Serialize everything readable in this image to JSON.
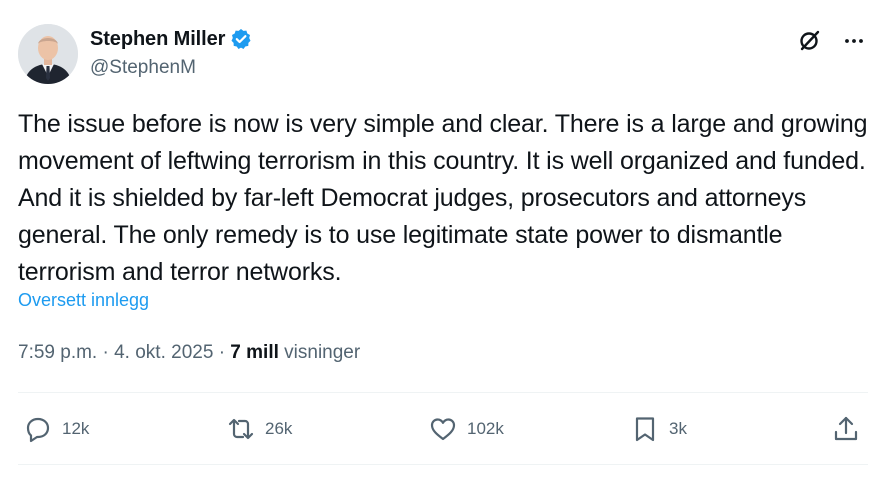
{
  "author": {
    "display_name": "Stephen Miller",
    "handle": "@StephenM",
    "verified": true,
    "verified_color": "#1d9bf0"
  },
  "header_actions": {
    "grok_icon": "grok-icon",
    "more_icon": "more-icon"
  },
  "tweet": {
    "text": "The issue before is now is very simple and clear. There is a large and growing movement of leftwing terrorism in this country. It is well organized and funded. And it is shielded by far-left Democrat judges, prosecutors and attorneys general. The only remedy is to use legitimate state power to dismantle terrorism and terror networks.",
    "translate_label": "Oversett innlegg"
  },
  "meta": {
    "time": "7:59 p.m.",
    "separator": "·",
    "date": "4. okt. 2025",
    "views_count": "7 mill",
    "views_label": "visninger"
  },
  "engagement": {
    "replies": "12k",
    "reposts": "26k",
    "likes": "102k",
    "bookmarks": "3k"
  },
  "colors": {
    "text": "#0f1419",
    "secondary": "#536471",
    "accent": "#1d9bf0",
    "divider": "#eff3f4"
  }
}
